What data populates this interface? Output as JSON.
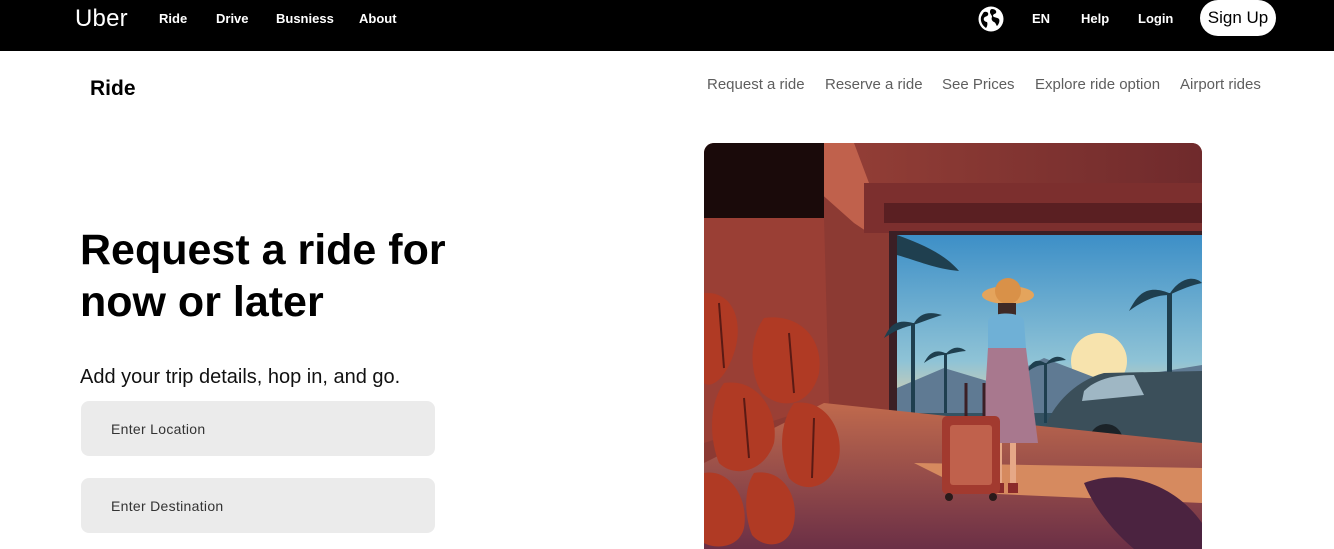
{
  "header": {
    "brand": "Uber",
    "nav": [
      "Ride",
      "Drive",
      "Busniess",
      "About"
    ],
    "language": "EN",
    "help": "Help",
    "login": "Login",
    "signup": "Sign Up"
  },
  "subnav": {
    "title": "Ride",
    "links": [
      "Request a ride",
      "Reserve a ride",
      "See Prices",
      "Explore ride option",
      "Airport rides"
    ]
  },
  "hero": {
    "title": "Request a ride for now or later",
    "subtitle": "Add your trip details, hop in, and go.",
    "location_placeholder": "Enter Location",
    "destination_placeholder": "Enter Destination"
  },
  "colors": {
    "nav_bg": "#000000",
    "field_bg": "#ebebeb",
    "sublink": "#5e5e5e"
  },
  "icons": {
    "globe": "globe-icon"
  }
}
